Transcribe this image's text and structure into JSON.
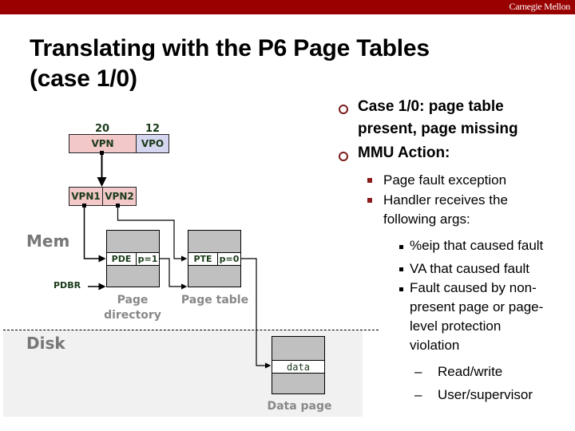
{
  "header": {
    "brand": "Carnegie Mellon",
    "bar_color": "#990000"
  },
  "title": {
    "line1": "Translating with the P6 Page Tables",
    "line2": "(case 1/0)"
  },
  "diagram": {
    "virtual_address": {
      "vpn_bits": "20",
      "vpo_bits": "12",
      "vpn_label": "VPN",
      "vpo_label": "VPO",
      "vpn1_label": "VPN1",
      "vpn2_label": "VPN2"
    },
    "regions": {
      "mem": "Mem",
      "disk": "Disk"
    },
    "pdbr_label": "PDBR",
    "page_directory": {
      "entry_name": "PDE",
      "entry_flag": "p=1",
      "caption_line1": "Page",
      "caption_line2": "directory"
    },
    "page_table": {
      "entry_name": "PTE",
      "entry_flag": "p=0",
      "caption": "Page table"
    },
    "data_page": {
      "entry_name": "data",
      "caption": "Data page"
    },
    "colors": {
      "vpn": "#f2c8c8",
      "vpo": "#d6d6f0",
      "page": "#c0c0c0",
      "disk_bg": "#f1f1f1"
    }
  },
  "bullets": {
    "level1": [
      {
        "lines": [
          "Case 1/0: page table",
          "present, page missing"
        ]
      },
      {
        "lines": [
          "MMU Action:"
        ]
      }
    ],
    "level2": [
      {
        "lines": [
          "Page fault exception"
        ]
      },
      {
        "lines": [
          "Handler receives the",
          "following args:"
        ]
      }
    ],
    "level3": [
      {
        "lines": [
          "%eip that caused fault"
        ]
      },
      {
        "lines": [
          "VA that caused fault"
        ]
      },
      {
        "lines": [
          "Fault caused by non-",
          "present page or page-",
          "level protection",
          "violation"
        ]
      }
    ],
    "level4": [
      {
        "lines": [
          "Read/write"
        ]
      },
      {
        "lines": [
          "User/supervisor"
        ]
      }
    ],
    "dash_glyph": "–"
  }
}
